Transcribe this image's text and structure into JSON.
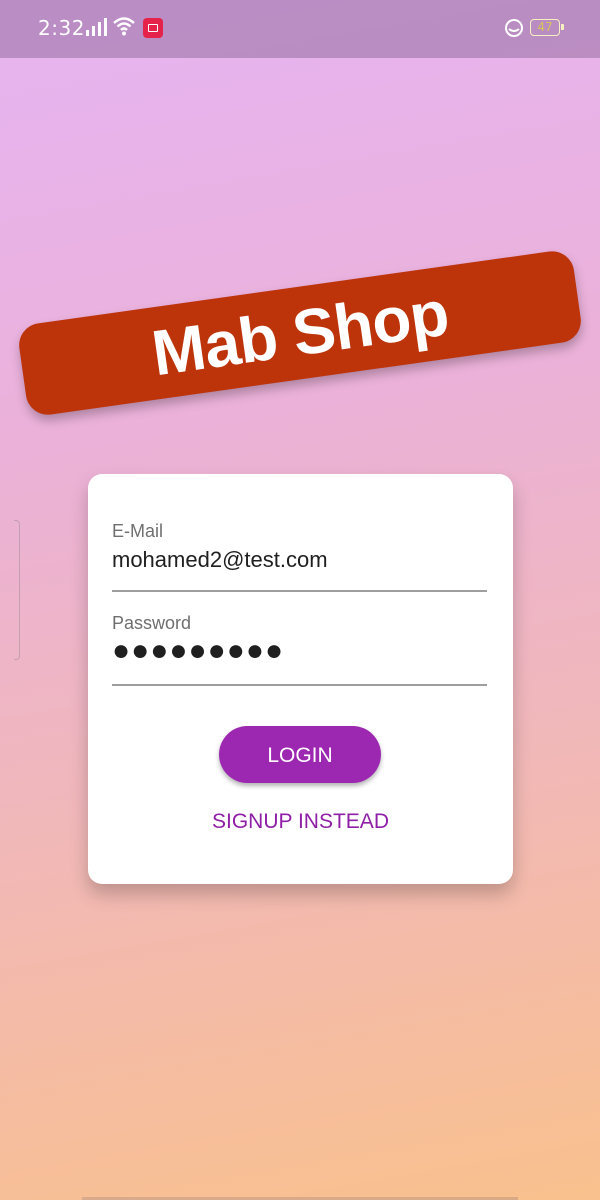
{
  "status_bar": {
    "time": "2:32",
    "battery": "47"
  },
  "brand": {
    "title": "Mab Shop",
    "banner_color": "#bd340b"
  },
  "login_form": {
    "email_label": "E-Mail",
    "email_value": "mohamed2@test.com",
    "password_label": "Password",
    "password_value": "●●●●●●●●●",
    "login_label": "LOGIN",
    "signup_label": "SIGNUP INSTEAD",
    "accent_color": "#9c27b0"
  }
}
